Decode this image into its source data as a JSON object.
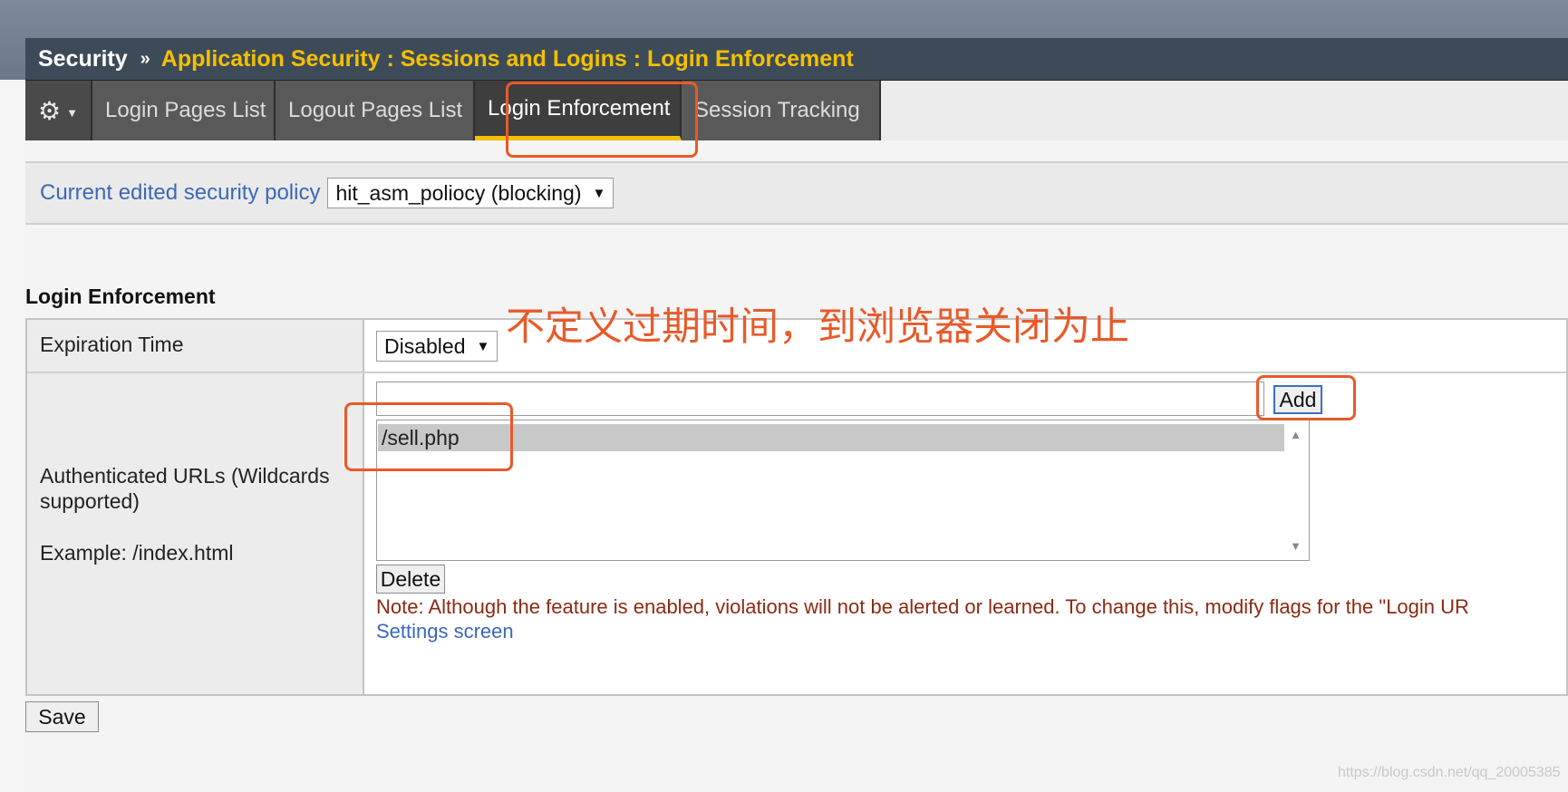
{
  "breadcrumb": {
    "section": "Security",
    "separator": "»",
    "path": "Application Security : Sessions and Logins : Login Enforcement"
  },
  "tabs": [
    {
      "label": "Login Pages List",
      "active": false
    },
    {
      "label": "Logout Pages List",
      "active": false
    },
    {
      "label": "Login Enforcement",
      "active": true
    },
    {
      "label": "Session Tracking",
      "active": false
    }
  ],
  "icons": {
    "menu": "gear-icon",
    "menu_caret": "chevron-down-icon",
    "dropdown": "triangle-down-icon"
  },
  "policy": {
    "label": "Current edited security policy",
    "selected": "hit_asm_poliocy (blocking)"
  },
  "login_enforcement": {
    "title": "Login Enforcement",
    "expiration_label": "Expiration Time",
    "expiration_value": "Disabled",
    "urls_label": "Authenticated URLs (Wildcards supported)",
    "example": "Example: /index.html",
    "url_input_value": "",
    "add_label": "Add",
    "urls": [
      "/sell.php"
    ],
    "delete_label": "Delete",
    "note": "Note: Although the feature is enabled, violations will not be alerted or learned. To change this, modify flags for the \"Login UR",
    "settings_link": "Settings screen"
  },
  "save_label": "Save",
  "annotation_text": "不定义过期时间，到浏览器关闭为止",
  "watermark": "https://blog.csdn.net/qq_20005385",
  "colors": {
    "accent_yellow": "#f5c000",
    "link_blue": "#3b68b8",
    "annotation_orange": "#e85a2a",
    "note_red": "#8b2a12"
  }
}
